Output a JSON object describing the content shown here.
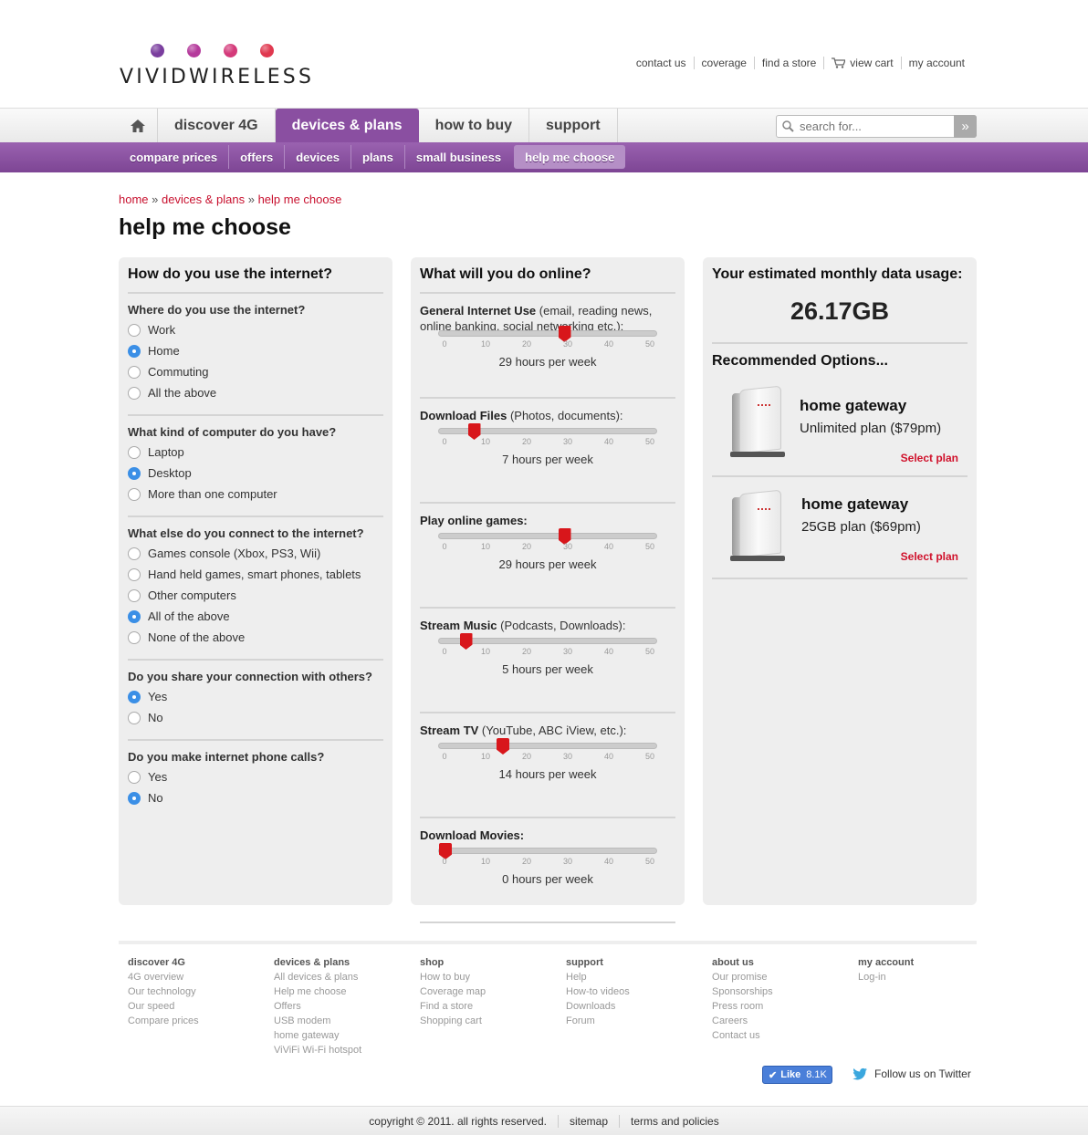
{
  "brand": {
    "logo_text": "VIVIDWIRELESS",
    "dot_colors": [
      "#7a3e9e",
      "#b53b9c",
      "#d43a7a",
      "#e0384f"
    ]
  },
  "toplinks": {
    "contact": "contact us",
    "coverage": "coverage",
    "store": "find a store",
    "cart": "view cart",
    "account": "my account"
  },
  "nav": {
    "items": [
      "discover 4G",
      "devices & plans",
      "how to buy",
      "support"
    ],
    "search_placeholder": "search for...",
    "search_btn": "»"
  },
  "subnav": {
    "items": [
      "compare prices",
      "offers",
      "devices",
      "plans",
      "small business",
      "help me choose"
    ]
  },
  "breadcrumb": {
    "home": "home",
    "sep1": "»",
    "devices": "devices & plans",
    "sep2": "»",
    "current": "help me choose"
  },
  "page_title": "help me choose",
  "left": {
    "title": "How do you use the internet?",
    "q1": {
      "label": "Where do you use the internet?",
      "options": [
        "Work",
        "Home",
        "Commuting",
        "All the above"
      ]
    },
    "q2": {
      "label": "What kind of computer do you have?",
      "options": [
        "Laptop",
        "Desktop",
        "More than one computer"
      ]
    },
    "q3": {
      "label": "What else do you connect to the internet?",
      "options": [
        "Games console (Xbox, PS3, Wii)",
        "Hand held games, smart phones, tablets",
        "Other computers",
        "All of the above",
        "None of the above"
      ]
    },
    "q4": {
      "label": "Do you share your connection with others?",
      "options": [
        "Yes",
        "No"
      ]
    },
    "q5": {
      "label": "Do you make internet phone calls?",
      "options": [
        "Yes",
        "No"
      ]
    }
  },
  "middle": {
    "title": "What will you do online?",
    "ticks": [
      "0",
      "10",
      "20",
      "30",
      "40",
      "50"
    ],
    "sliders": [
      {
        "bold": "General Internet Use",
        "rest": " (email, reading news, online banking, social networking etc.):",
        "value": 29,
        "hours": "29 hours per week"
      },
      {
        "bold": "Download Files",
        "rest": " (Photos, documents):",
        "value": 7,
        "hours": "7 hours per week"
      },
      {
        "bold": "Play online games:",
        "rest": "",
        "value": 29,
        "hours": "29 hours per week"
      },
      {
        "bold": "Stream Music",
        "rest": " (Podcasts, Downloads):",
        "value": 5,
        "hours": "5 hours per week"
      },
      {
        "bold": "Stream TV",
        "rest": " (YouTube, ABC iView, etc.):",
        "value": 14,
        "hours": "14 hours per week"
      },
      {
        "bold": "Download Movies:",
        "rest": "",
        "value": 0,
        "hours": "0 hours per week"
      }
    ]
  },
  "right": {
    "title": "Your estimated monthly data usage:",
    "usage": "26.17GB",
    "recommended": "Recommended Options...",
    "products": [
      {
        "name": "home gateway",
        "plan": "Unlimited plan ($79pm)",
        "select": "Select plan"
      },
      {
        "name": "home gateway",
        "plan": "25GB plan ($69pm)",
        "select": "Select plan"
      }
    ]
  },
  "footer": {
    "cols": [
      {
        "head": "discover 4G",
        "links": [
          "4G overview",
          "Our technology",
          "Our speed",
          "Compare prices"
        ]
      },
      {
        "head": "devices & plans",
        "links": [
          "All devices & plans",
          "Help me choose",
          "Offers",
          "USB modem",
          "home gateway",
          "ViViFi Wi-Fi hotspot"
        ]
      },
      {
        "head": "shop",
        "links": [
          "How to buy",
          "Coverage map",
          "Find a store",
          "Shopping cart"
        ]
      },
      {
        "head": "support",
        "links": [
          "Help",
          "How-to videos",
          "Downloads",
          "Forum"
        ]
      },
      {
        "head": "about us",
        "links": [
          "Our promise",
          "Sponsorships",
          "Press room",
          "Careers",
          "Contact us"
        ]
      },
      {
        "head": "my account",
        "links": [
          "Log-in"
        ]
      }
    ],
    "like": "Like",
    "like_count": "8.1K",
    "twitter": "Follow us on Twitter",
    "copyright": "copyright © 2011. all rights reserved.",
    "sitemap": "sitemap",
    "terms": "terms and policies"
  }
}
